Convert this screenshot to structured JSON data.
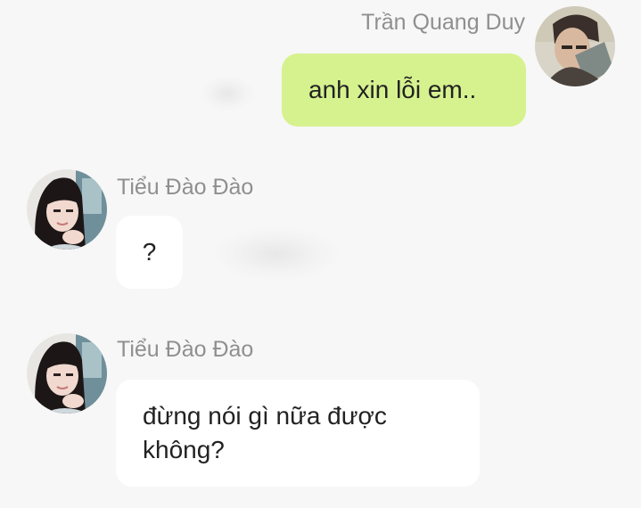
{
  "colors": {
    "background": "#f7f7f7",
    "outgoing_bubble": "#d6f28f",
    "incoming_bubble": "#ffffff",
    "sender_name": "#8f8f8f",
    "message_text": "#222222"
  },
  "messages": [
    {
      "sender": "Trần Quang Duy",
      "direction": "outgoing",
      "avatar_icon": "user-photo-avatar-icon",
      "text": "anh xin lỗi em.."
    },
    {
      "sender": "Tiểu Đào Đào",
      "direction": "incoming",
      "avatar_icon": "user-photo-avatar-icon",
      "text": "?"
    },
    {
      "sender": "Tiểu Đào Đào",
      "direction": "incoming",
      "avatar_icon": "user-photo-avatar-icon",
      "text_lines": [
        "đừng nói gì nữa được",
        "không?"
      ]
    }
  ]
}
